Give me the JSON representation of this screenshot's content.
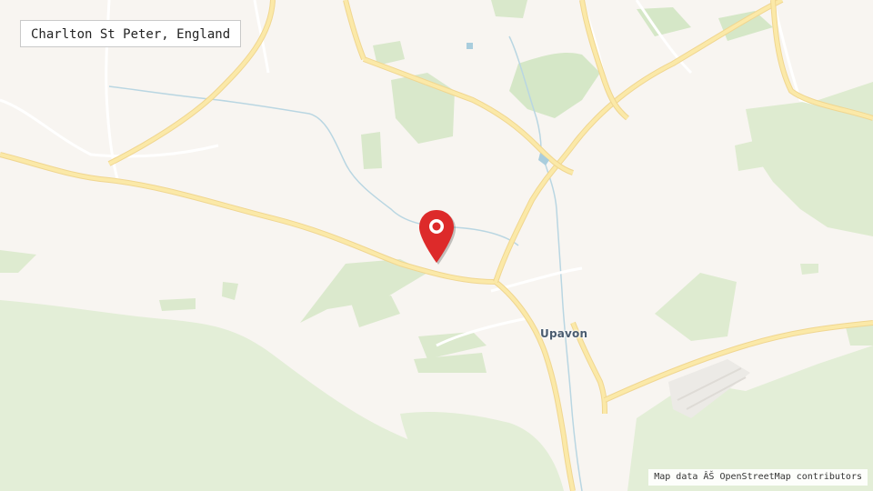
{
  "location_label": "Charlton St Peter, England",
  "place_labels": {
    "upavon": "Upavon"
  },
  "attribution": "Map data ÂŠ OpenStreetMap contributors",
  "marker": {
    "icon": "map-pin-icon",
    "color": "#dd2a2a"
  },
  "colors": {
    "land": "#f8f5f1",
    "green": "#deedd0",
    "road": "#fbe9a8",
    "road_edge": "#f0d690",
    "water": "#a9cddd",
    "place_label": "#4a5c70"
  }
}
